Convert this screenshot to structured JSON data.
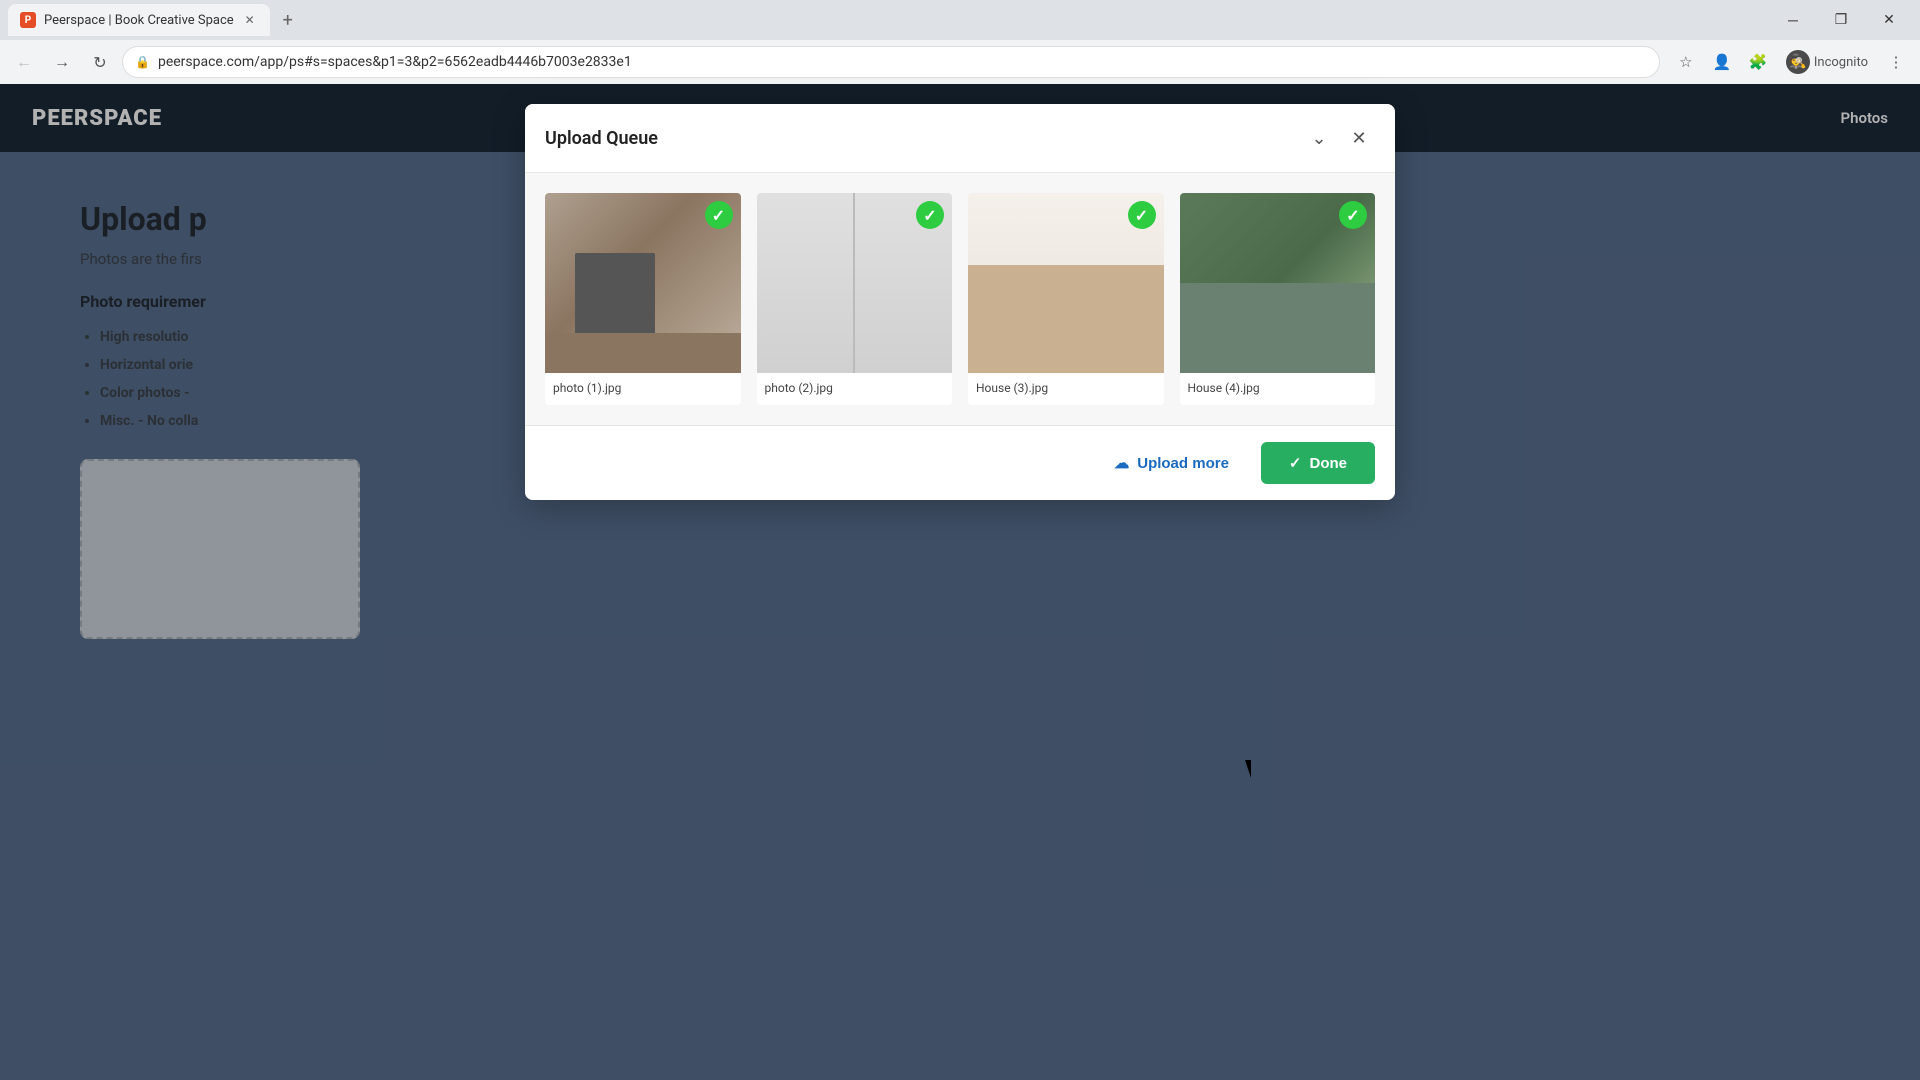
{
  "browser": {
    "tab_title": "Peerspace | Book Creative Space",
    "tab_favicon": "P",
    "url": "peerspace.com/app/ps#s=spaces&p1=3&p2=6562eadb4446b7003e2833e1",
    "url_full": "peerspace.com/app/ps#s=spaces&p1=3&p2=6562eadb4446b7003e2833e1",
    "incognito_label": "Incognito",
    "window_controls": {
      "minimize": "─",
      "maximize": "□",
      "close": "✕"
    }
  },
  "header": {
    "logo": "PEERSPACE",
    "nav_item": "Photos"
  },
  "page": {
    "title": "Upload p",
    "subtitle": "Photos are the firs",
    "subtitle_full": "Photos are the first thing a booker sees, so upload great photos.",
    "section_title": "Photo requiremer",
    "bullets": [
      "High resolutio",
      "Horizontal orie",
      "Color photos -",
      "Misc. - No colla"
    ]
  },
  "modal": {
    "title": "Upload Queue",
    "minimize_icon": "⌄",
    "close_icon": "✕",
    "photos": [
      {
        "id": 1,
        "filename": "photo (1).jpg",
        "thumb_class": "photo-thumb-1",
        "checked": true
      },
      {
        "id": 2,
        "filename": "photo (2).jpg",
        "thumb_class": "photo-thumb-2",
        "checked": true
      },
      {
        "id": 3,
        "filename": "House (3).jpg",
        "thumb_class": "photo-thumb-3",
        "checked": true
      },
      {
        "id": 4,
        "filename": "House (4).jpg",
        "thumb_class": "photo-thumb-4",
        "checked": true
      }
    ],
    "footer": {
      "upload_more_label": "Upload more",
      "done_label": "Done",
      "upload_icon": "☁",
      "done_icon": "✓"
    }
  }
}
